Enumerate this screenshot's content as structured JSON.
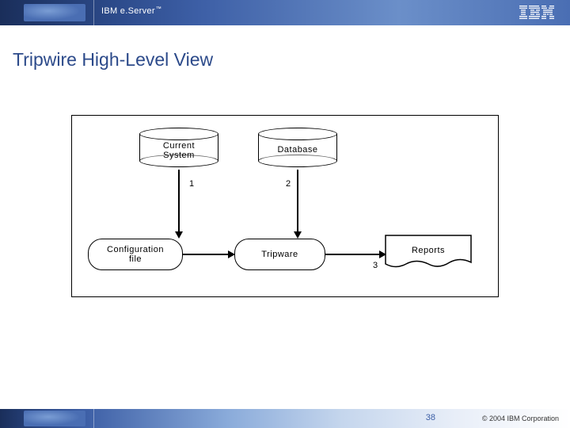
{
  "header": {
    "brand": "IBM e.Server",
    "tm": "™"
  },
  "slide": {
    "title": "Tripwire High-Level View"
  },
  "diagram": {
    "current_system": "Current\nSystem",
    "database": "Database",
    "config_file": "Configuration\nfile",
    "tripware": "Tripware",
    "reports": "Reports",
    "n1": "1",
    "n2": "2",
    "n3": "3"
  },
  "footer": {
    "page": "38",
    "copyright": "© 2004 IBM Corporation"
  }
}
